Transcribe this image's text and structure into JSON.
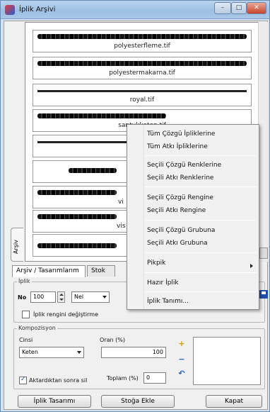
{
  "window": {
    "title": "İplik Arşivi",
    "minimize": "–",
    "maximize": "□",
    "close": "✕"
  },
  "yarns": [
    {
      "label": "polyesterfleme.tif"
    },
    {
      "label": "polyestermakarna.tif"
    },
    {
      "label": "royal.tif"
    },
    {
      "label": "santukketen.tif"
    },
    {
      "label": "san"
    },
    {
      "label": ""
    },
    {
      "label": "vi"
    },
    {
      "label": "vis"
    },
    {
      "label": ""
    }
  ],
  "side_tab": "Arşiv",
  "tabs": [
    "Arşiv / Tasarımlarım",
    "Stok"
  ],
  "iplik": {
    "group_title": "İplik",
    "no_label": "No",
    "no_value": "100",
    "type_value": "Nel",
    "keep_color_label": "İplik rengini değiştirme"
  },
  "kompozisyon": {
    "group_title": "Kompozisyon",
    "cinsi_label": "Cinsi",
    "cinsi_value": "Keten",
    "oran_label": "Oran (%)",
    "oran_value": "100",
    "add_icon": "+",
    "remove_icon": "−",
    "undo_icon": "↶",
    "aktar_label": "Aktardıktan sonra sil",
    "toplam_label": "Toplam (%)",
    "toplam_value": "0"
  },
  "buttons": {
    "iplik_tasarimi": "İplik Tasarımı",
    "stoga_ekle": "Stoğa Ekle",
    "kapat": "Kapat"
  },
  "context_menu": {
    "items": [
      "Tüm Çözgü İpliklerine",
      "Tüm Atkı İpliklerine",
      "Seçili Çözgü Renklerine",
      "Seçili Atkı Renklerine",
      "Seçili Çözgü Rengine",
      "Seçili Atkı Rengine",
      "Seçili Çözgü Grubuna",
      "Seçili Atkı Grubuna",
      "Pikpik",
      "Hazır İplik",
      "İplik Tanımı..."
    ]
  }
}
